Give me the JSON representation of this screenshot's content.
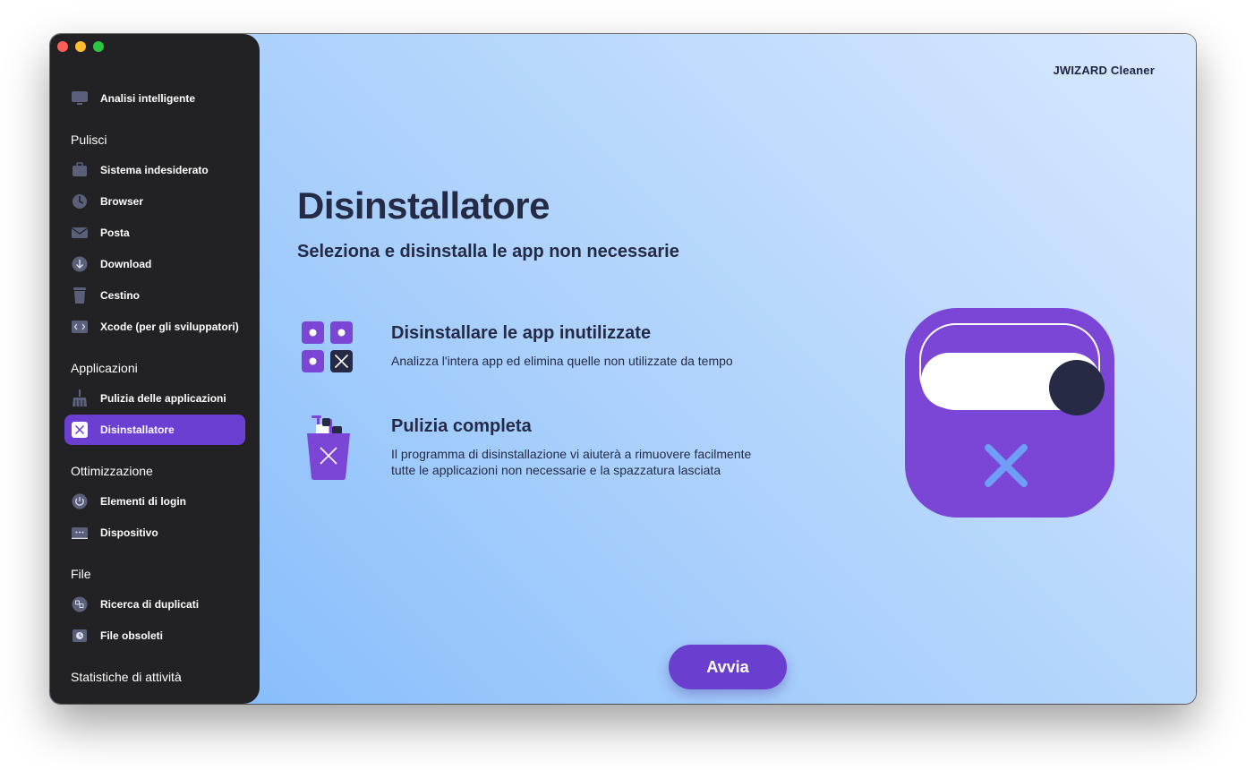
{
  "app": {
    "brand": "JWIZARD Cleaner"
  },
  "sidebar": {
    "top_item": {
      "label": "Analisi intelligente"
    },
    "sections": [
      {
        "title": "Pulisci",
        "items": [
          {
            "label": "Sistema indesiderato"
          },
          {
            "label": "Browser"
          },
          {
            "label": "Posta"
          },
          {
            "label": "Download"
          },
          {
            "label": "Cestino"
          },
          {
            "label": "Xcode (per gli sviluppatori)"
          }
        ]
      },
      {
        "title": "Applicazioni",
        "items": [
          {
            "label": "Pulizia delle applicazioni"
          },
          {
            "label": "Disinstallatore",
            "active": true
          }
        ]
      },
      {
        "title": "Ottimizzazione",
        "items": [
          {
            "label": "Elementi di login"
          },
          {
            "label": "Dispositivo"
          }
        ]
      },
      {
        "title": "File",
        "items": [
          {
            "label": "Ricerca di duplicati"
          },
          {
            "label": "File obsoleti"
          }
        ]
      },
      {
        "title": "Statistiche di attività",
        "items": []
      }
    ]
  },
  "main": {
    "title": "Disinstallatore",
    "subtitle": "Seleziona e disinstalla le app non necessarie",
    "features": [
      {
        "title": "Disinstallare le app inutilizzate",
        "lines": [
          "Analizza l'intera app ed elimina quelle non utilizzate da tempo"
        ]
      },
      {
        "title": "Pulizia completa",
        "lines": [
          "Il programma di disinstallazione vi aiuterà a rimuovere facilmente",
          "tutte le applicazioni non necessarie e la spazzatura lasciata"
        ]
      }
    ],
    "start_button": "Avvia"
  },
  "colors": {
    "sidebar_bg": "#222224",
    "accent": "#6b3fd1",
    "text_dark": "#252b45",
    "icon_purple": "#7b45d6"
  },
  "icons": [
    "monitor-icon",
    "briefcase-icon",
    "browser-icon",
    "mail-icon",
    "download-icon",
    "trash-icon",
    "code-icon",
    "broom-icon",
    "uninstall-x-icon",
    "power-icon",
    "device-icon",
    "duplicates-icon",
    "clock-file-icon"
  ]
}
